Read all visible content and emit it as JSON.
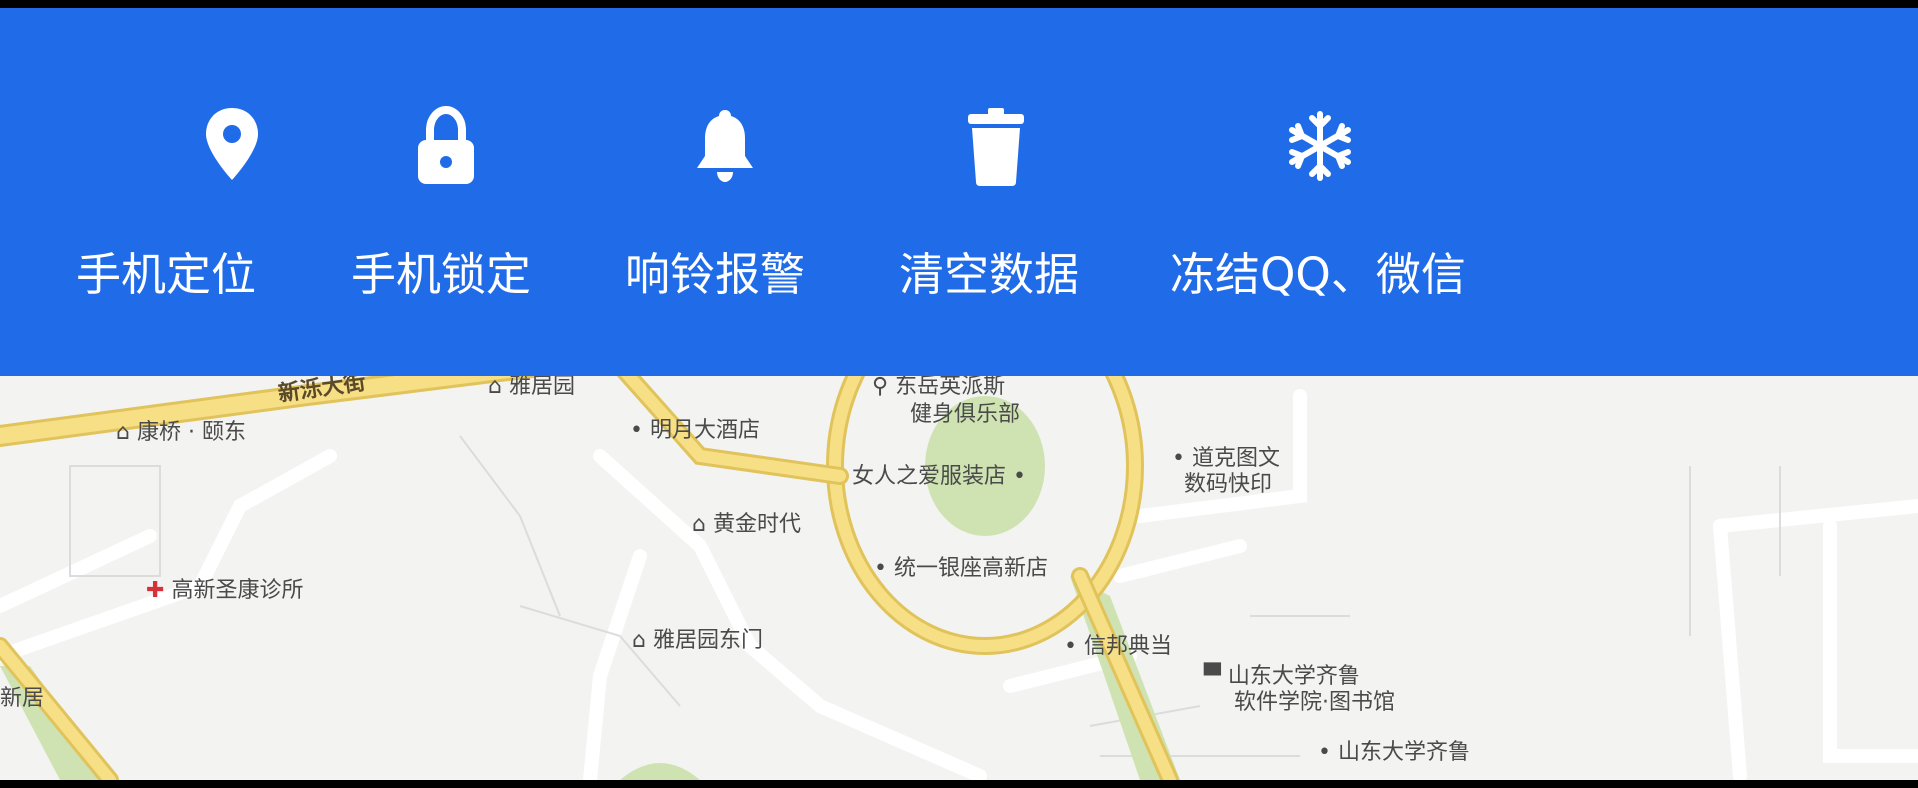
{
  "actions": [
    {
      "label": "手机定位",
      "icon": "location-pin-icon"
    },
    {
      "label": "手机锁定",
      "icon": "lock-icon"
    },
    {
      "label": "响铃报警",
      "icon": "bell-icon"
    },
    {
      "label": "清空数据",
      "icon": "trash-icon"
    },
    {
      "label": "冻结QQ、微信",
      "icon": "snowflake-icon"
    }
  ],
  "map": {
    "road": "新泺大街",
    "pois": [
      "雅居园",
      "康桥 · 颐东",
      "明月大酒店",
      "东岳英派斯",
      "健身俱乐部",
      "女人之爱服装店",
      "道克图文",
      "数码快印",
      "黄金时代",
      "统一银座高新店",
      "高新圣康诊所",
      "雅居园东门",
      "信邦典当",
      "山东大学齐鲁",
      "软件学院·图书馆",
      "新居",
      "山东大学齐鲁"
    ]
  },
  "colors": {
    "toolbar": "#206be8",
    "map_bg": "#f3f3f1",
    "road": "#f7df86",
    "road_edge": "#e1c35b",
    "park": "#cfe3b2"
  }
}
